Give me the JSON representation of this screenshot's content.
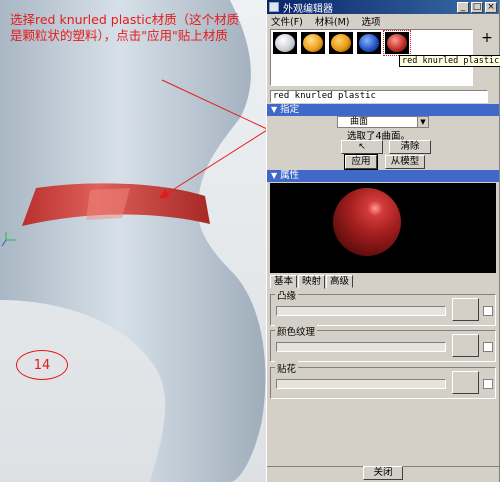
{
  "annotation": {
    "text": "选择red knurled plastic材质（这个材质是颗粒状的塑料），点击\"应用\"贴上材质",
    "step": "14"
  },
  "dialog": {
    "title": "外观编辑器",
    "window_buttons": [
      "_",
      "□",
      "×"
    ],
    "menu": [
      "文件(F)",
      "材料(M)",
      "选项"
    ],
    "swatches": [
      {
        "name": "white",
        "color": "#e8eaee"
      },
      {
        "name": "yellow",
        "color": "#f0a020"
      },
      {
        "name": "orange",
        "color": "#e89a10"
      },
      {
        "name": "blue",
        "color": "#2456c8"
      },
      {
        "name": "red knurled plastic",
        "color": "#c0302a"
      }
    ],
    "tooltip": "red knurled plastic",
    "add_label": "+",
    "remove_label": "−",
    "material_name": "red knurled plastic",
    "assign_section": {
      "title": "指定",
      "combo_value": "曲面",
      "selection_info": "选取了4曲面。",
      "clear_label": "清除",
      "apply_label": "应用",
      "from_model_label": "从模型"
    },
    "properties_section": {
      "title": "属性",
      "tabs": [
        "基本",
        "映射",
        "高级"
      ],
      "active_tab": "映射",
      "groups": [
        "凸缘",
        "颜色纹理",
        "贴花"
      ]
    },
    "close_label": "关闭"
  },
  "colors": {
    "accent": "#e41b1b",
    "section_blue": "#3f68c9",
    "model_body": "#c9d4de",
    "model_band": "#c8403c"
  }
}
